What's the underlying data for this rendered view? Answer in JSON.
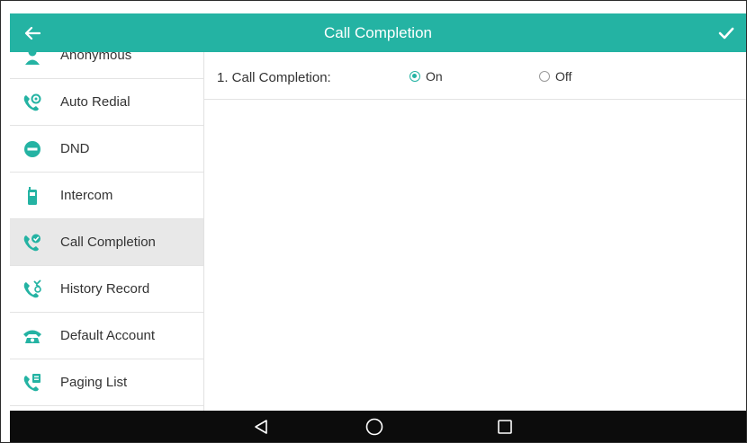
{
  "header": {
    "title": "Call Completion",
    "back_icon": "arrow-left-icon",
    "confirm_icon": "checkmark-icon",
    "color": "#24b3a3"
  },
  "sidebar": {
    "items": [
      {
        "label": "Anonymous",
        "icon": "anonymous-icon"
      },
      {
        "label": "Auto Redial",
        "icon": "auto-redial-icon"
      },
      {
        "label": "DND",
        "icon": "dnd-icon"
      },
      {
        "label": "Intercom",
        "icon": "intercom-icon"
      },
      {
        "label": "Call Completion",
        "icon": "call-completion-icon",
        "active": true
      },
      {
        "label": "History Record",
        "icon": "history-record-icon"
      },
      {
        "label": "Default Account",
        "icon": "default-account-icon"
      },
      {
        "label": "Paging List",
        "icon": "paging-list-icon"
      }
    ]
  },
  "settings": {
    "call_completion": {
      "label": "1. Call Completion:",
      "options": [
        {
          "label": "On",
          "checked": true
        },
        {
          "label": "Off",
          "checked": false
        }
      ]
    }
  },
  "navbar": {
    "buttons": [
      "back-triangle-icon",
      "home-circle-icon",
      "recents-square-icon"
    ]
  }
}
